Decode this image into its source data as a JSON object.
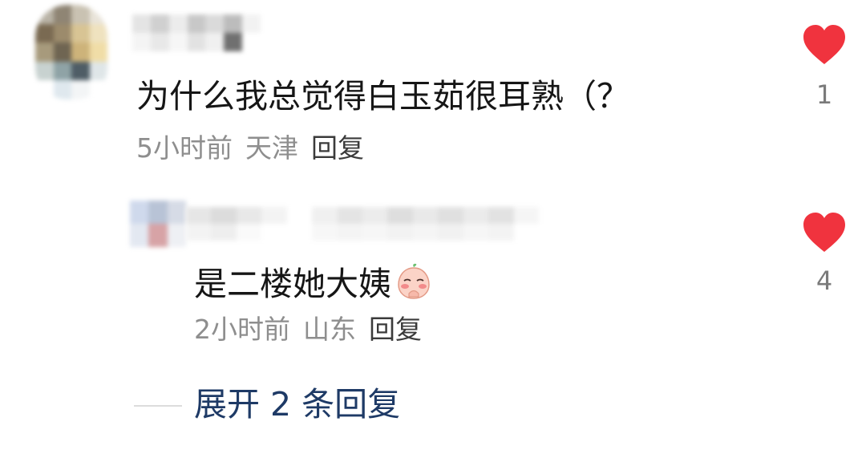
{
  "comment": {
    "text": "为什么我总觉得白玉茹很耳熟（？",
    "time": "5小时前",
    "location": "天津",
    "reply_label": "回复",
    "like_count": "1"
  },
  "reply": {
    "text": "是二楼她大姨",
    "emoji_name": "shy-peach-emoji",
    "time": "2小时前",
    "location": "山东",
    "reply_label": "回复",
    "like_count": "4"
  },
  "expand": {
    "label": "展开 2 条回复"
  },
  "icons": {
    "like": "heart-icon"
  },
  "colors": {
    "heart": "#f0333e",
    "expand_link": "#1e3a66",
    "meta_text": "#8e8e8e"
  }
}
